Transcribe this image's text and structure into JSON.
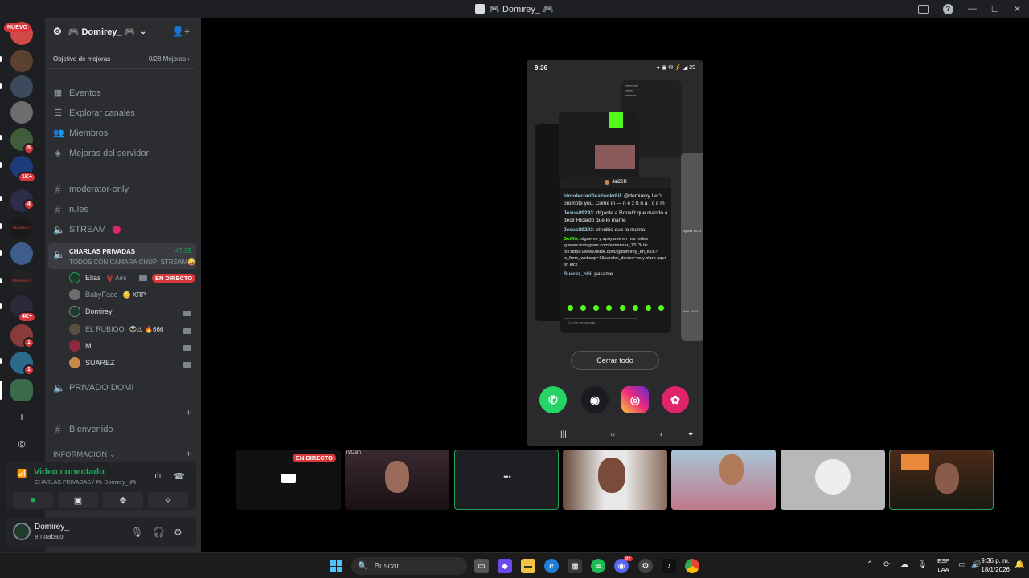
{
  "window": {
    "title": "🎮 Domirey_ 🎮"
  },
  "rail": {
    "new_label": "NUEVO",
    "badges": [
      "5",
      "1K+",
      "4",
      "4K+",
      "1",
      "1"
    ],
    "server_labels": [
      "DESPECT",
      "DESPECT"
    ]
  },
  "server": {
    "name": "🎮 Domirey_ 🎮",
    "boost_label": "Objetivo de mejoras",
    "boost_progress": "0/28 Mejoras",
    "nav": [
      "Eventos",
      "Explorar canales",
      "Miembros",
      "Mejoras del servidor"
    ],
    "channels": {
      "moderator": "moderator-only",
      "rules": "rules",
      "stream": "STREAM",
      "voice_name": "CHARLAS PRIVADAS",
      "voice_time": "47:29",
      "voice_status": "TODOS CON CAMARA CHUPI STREAM🤪",
      "private": "PRIVADO DOMI",
      "welcome": "Bienvenido",
      "info_category": "INFORMACION"
    },
    "voice_members": [
      {
        "name": "Elias",
        "extra": "🦞 Ami",
        "live": "EN DIRECTO"
      },
      {
        "name": "BabyFace",
        "extra": "🪙 XRP"
      },
      {
        "name": "Domirey_",
        "extra": ""
      },
      {
        "name": "EL RUBIOO",
        "extra": "👽⚠ 🔥666"
      },
      {
        "name": "M...",
        "extra": ""
      },
      {
        "name": "SUAREZ",
        "extra": ""
      }
    ]
  },
  "rtc": {
    "status": "Video conectado",
    "subtitle": "CHARLAS PRIVADAS / 🎮 Domirey_ 🎮"
  },
  "user": {
    "name": "Domirey_",
    "status": "en trabajo"
  },
  "phone": {
    "time": "9:36",
    "battery": "29",
    "header_user": "Jal26R",
    "chat": [
      {
        "user": "blondeclarificationkr8il",
        "text": ": @domireyy Let's promote you. Come in — n e z h n a . c o m"
      },
      {
        "user": "Jesusit9293",
        "text": ": díganle a Ronald que mandó a decir Ricardo que lo mame"
      },
      {
        "user": "Jesusit9293",
        "text": ": el rubio que lo mama"
      },
      {
        "user": "BotRix",
        "text": ": sígueme y apóyame en mis redes ig:www.instagram.com/almanzar_1313/ tik tok:https://www.tiktok.com/@domirey_en_kick?is_from_webapp=1&sender_device=pc y claro aqui en kick"
      },
      {
        "user": "Suarez_ofii",
        "text": ": pasame"
      }
    ],
    "input_placeholder": "Enviar mensaje",
    "close_all": "Cerrar todo",
    "side_labels": [
      "Agrelis 19:33",
      "Julio 10:01"
    ]
  },
  "tiles": {
    "live_label": "EN DIRECTO",
    "cam_label": "iVCam",
    "more_label": "•••"
  },
  "taskbar": {
    "search_placeholder": "Buscar",
    "discord_badge": "9+",
    "lang_top": "ESP",
    "lang_bottom": "LAA",
    "time": "9:36 p. m.",
    "date": "18/1/2026"
  }
}
